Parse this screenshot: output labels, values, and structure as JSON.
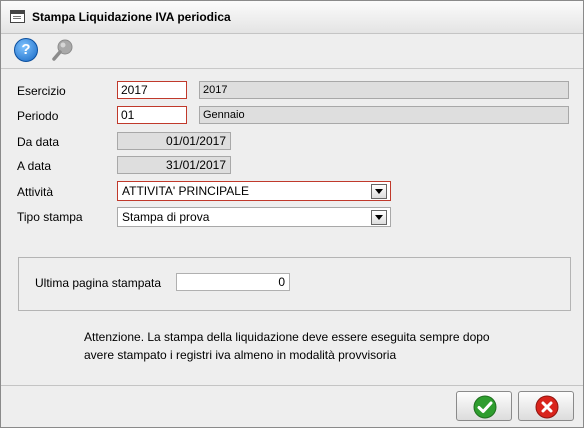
{
  "window": {
    "title": "Stampa Liquidazione IVA periodica"
  },
  "toolbar": {
    "help_icon": "help-icon",
    "search_icon": "search-icon",
    "help_glyph": "?"
  },
  "form": {
    "esercizio": {
      "label": "Esercizio",
      "value": "2017",
      "description": "2017"
    },
    "periodo": {
      "label": "Periodo",
      "value": "01",
      "description": "Gennaio"
    },
    "da_data": {
      "label": "Da data",
      "value": "01/01/2017"
    },
    "a_data": {
      "label": "A data",
      "value": "31/01/2017"
    },
    "attivita": {
      "label": "Attività",
      "value": "ATTIVITA' PRINCIPALE"
    },
    "tipo_stampa": {
      "label": "Tipo stampa",
      "value": "Stampa di prova"
    }
  },
  "panel": {
    "label": "Ultima pagina stampata",
    "value": "0"
  },
  "note": {
    "line1": "Attenzione. La stampa della liquidazione deve essere eseguita sempre dopo",
    "line2": "avere stampato i registri iva almeno in modalità provvisoria"
  },
  "buttons": {
    "confirm_icon": "check-icon",
    "cancel_icon": "cancel-icon"
  },
  "colors": {
    "confirm": "#2e9d2e",
    "cancel": "#d9241c",
    "required_border": "#c0392b"
  }
}
